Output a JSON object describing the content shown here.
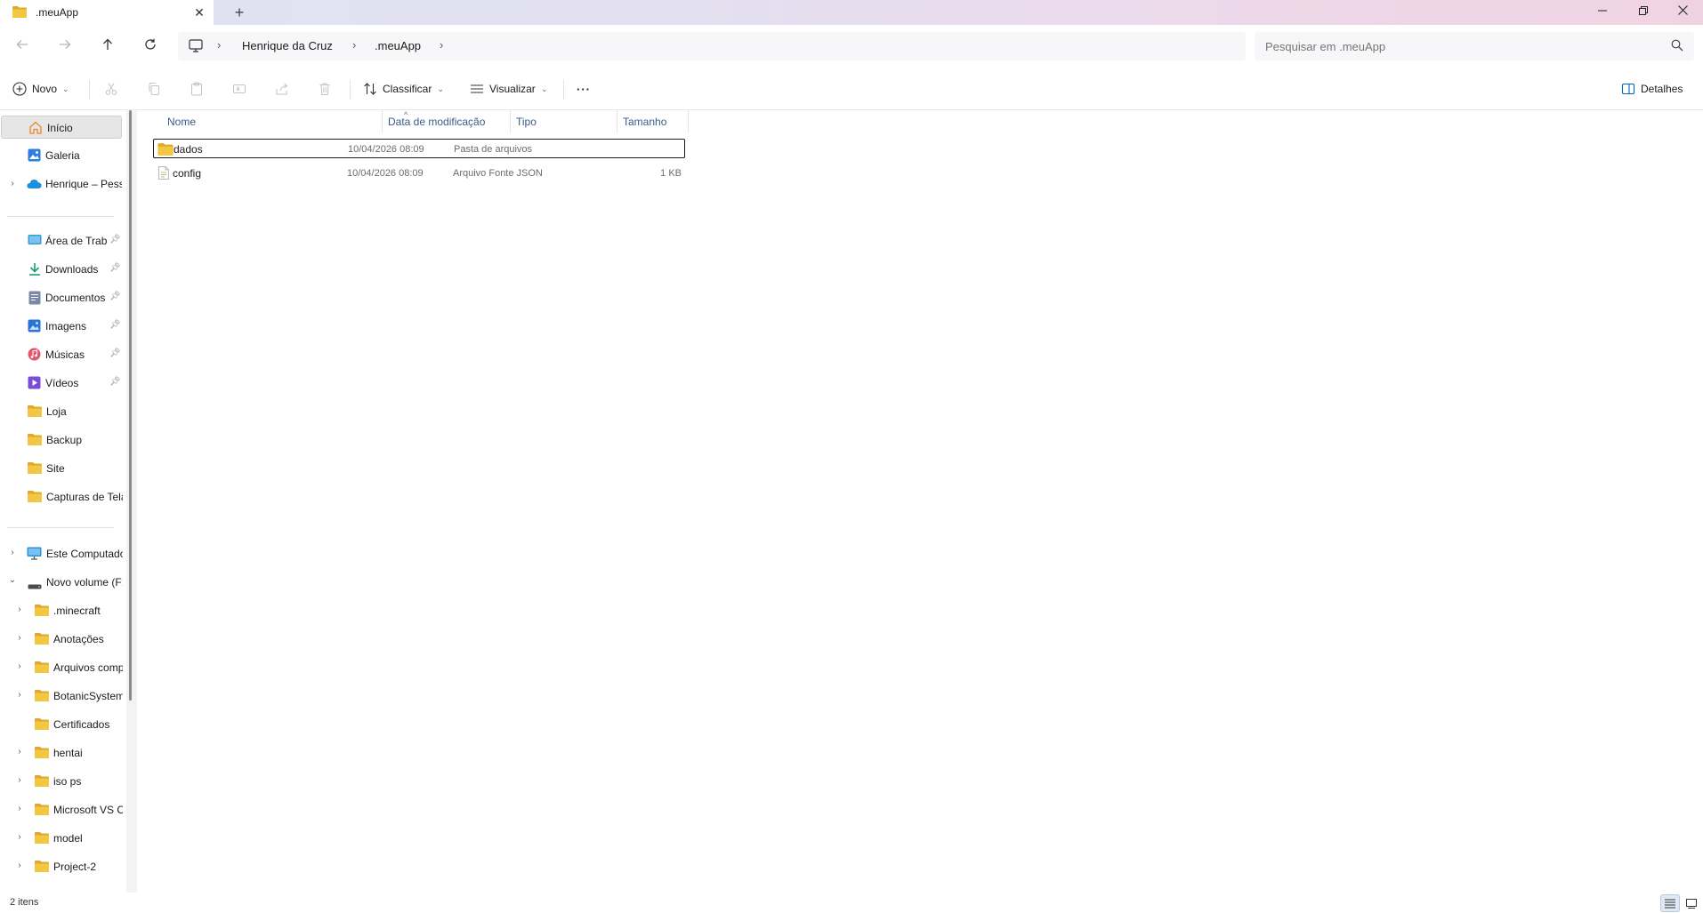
{
  "window": {
    "tab_title": ".meuApp",
    "new_tab_symbol": "+",
    "close_tab_symbol": "✕",
    "minimize_symbol": "—",
    "maximize_symbol": "❐",
    "close_symbol": "✕"
  },
  "address": {
    "breadcrumbs": [
      "Henrique da Cruz",
      ".meuApp"
    ],
    "separator": "›"
  },
  "search": {
    "placeholder": "Pesquisar em .meuApp"
  },
  "toolbar": {
    "new_label": "Novo",
    "sort_label": "Classificar",
    "view_label": "Visualizar",
    "more_label": "···",
    "details_label": "Detalhes"
  },
  "sidebar": {
    "items": [
      {
        "label": "Início"
      },
      {
        "label": "Galeria"
      },
      {
        "label": "Henrique – Pessoal"
      },
      {
        "label": "Área de Trabalho"
      },
      {
        "label": "Downloads"
      },
      {
        "label": "Documentos"
      },
      {
        "label": "Imagens"
      },
      {
        "label": "Músicas"
      },
      {
        "label": "Vídeos"
      },
      {
        "label": "Loja"
      },
      {
        "label": "Backup"
      },
      {
        "label": "Site"
      },
      {
        "label": "Capturas de Tela"
      },
      {
        "label": "Este Computador"
      },
      {
        "label": "Novo volume (F:)"
      },
      {
        "label": ".minecraft"
      },
      {
        "label": "Anotações"
      },
      {
        "label": "Arquivos compartilhados"
      },
      {
        "label": "BotanicSystem"
      },
      {
        "label": "Certificados"
      },
      {
        "label": "hentai"
      },
      {
        "label": "iso ps"
      },
      {
        "label": "Microsoft VS Code"
      },
      {
        "label": "model"
      },
      {
        "label": "Project-2"
      }
    ]
  },
  "columns": {
    "name": "Nome",
    "modified": "Data de modificação",
    "type": "Tipo",
    "size": "Tamanho"
  },
  "files": [
    {
      "name": "dados",
      "modified": "10/04/2026 08:09",
      "type": "Pasta de arquivos",
      "size": ""
    },
    {
      "name": "config",
      "modified": "10/04/2026 08:09",
      "type": "Arquivo Fonte JSON",
      "size": "1 KB"
    }
  ],
  "status": {
    "item_count": "2 itens"
  },
  "colors": {
    "folder": "#f2c744",
    "folder_dark": "#e0a92a",
    "accent": "#0067c0",
    "onedrive": "#1a8ee0"
  }
}
